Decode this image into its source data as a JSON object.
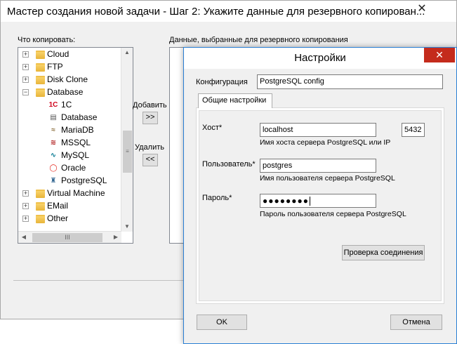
{
  "wizard": {
    "title": "Мастер создания новой задачи - Шаг 2: Укажите данные для резервного копирован...",
    "close_glyph": "✕",
    "source_label": "Что копировать:",
    "selected_label": "Данные, выбранные для резервного копирования",
    "add_label": "Добавить",
    "add_btn": ">>",
    "remove_label": "Удалить",
    "remove_btn": "<<",
    "tree": [
      {
        "label": "Cloud",
        "type": "folder",
        "expanded": false
      },
      {
        "label": "FTP",
        "type": "folder",
        "expanded": false
      },
      {
        "label": "Disk Clone",
        "type": "folder",
        "expanded": false
      },
      {
        "label": "Database",
        "type": "folder",
        "expanded": true
      },
      {
        "label": "1C",
        "type": "item",
        "icon": "1c-icon"
      },
      {
        "label": "Database",
        "type": "item",
        "icon": "database-icon"
      },
      {
        "label": "MariaDB",
        "type": "item",
        "icon": "mariadb-icon"
      },
      {
        "label": "MSSQL",
        "type": "item",
        "icon": "mssql-icon"
      },
      {
        "label": "MySQL",
        "type": "item",
        "icon": "mysql-icon"
      },
      {
        "label": "Oracle",
        "type": "item",
        "icon": "oracle-icon"
      },
      {
        "label": "PostgreSQL",
        "type": "item",
        "icon": "postgresql-icon"
      },
      {
        "label": "Virtual Machine",
        "type": "folder",
        "expanded": false
      },
      {
        "label": "EMail",
        "type": "folder",
        "expanded": false
      },
      {
        "label": "Other",
        "type": "folder",
        "expanded": false
      }
    ]
  },
  "dialog": {
    "title": "Настройки",
    "close_glyph": "✕",
    "config_label": "Конфигурация",
    "config_value": "PostgreSQL config",
    "tab_label": "Общие настройки",
    "host_label": "Хост*",
    "host_value": "localhost",
    "port_value": "5432",
    "host_hint": "Имя хоста сервера PostgreSQL или IP",
    "user_label": "Пользователь*",
    "user_value": "postgres",
    "user_hint": "Имя пользователя сервера PostgreSQL",
    "password_label": "Пароль*",
    "password_value": "●●●●●●●●",
    "password_hint": "Пароль пользователя сервера PostgreSQL",
    "test_button": "Проверка соединения",
    "ok_button": "OK",
    "cancel_button": "Отмена"
  },
  "colors": {
    "accent": "#2a7fd4",
    "close_red": "#c42b1c",
    "folder": "#f0c04a"
  }
}
